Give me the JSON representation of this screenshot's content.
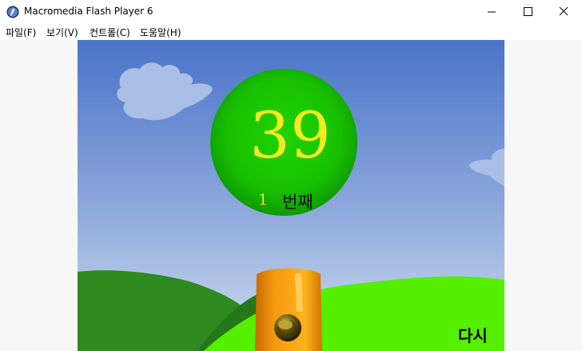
{
  "window": {
    "title": "Macromedia Flash Player 6",
    "icon": "flash-player-icon"
  },
  "menu": {
    "items": [
      "파일(F)",
      "보기(V)",
      "컨트롤(C)",
      "도움말(H)"
    ]
  },
  "game": {
    "number": "39",
    "count": "1",
    "count_label": "번째",
    "retry_label": "다시"
  },
  "colors": {
    "sky_top": "#4a73c9",
    "sky_bottom": "#c8d6ee",
    "ball": "#17c400",
    "hill_front": "#55f000",
    "hill_back": "#2e8a1e",
    "cannon": "#f08c08"
  }
}
